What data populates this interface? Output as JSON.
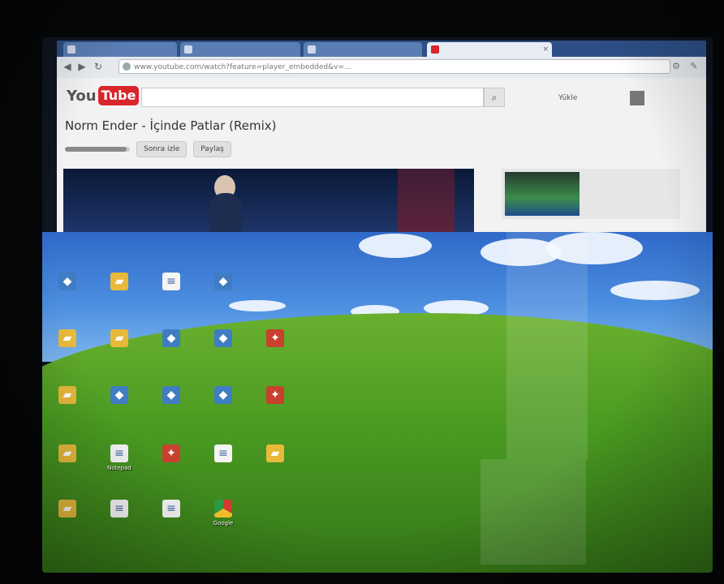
{
  "browser": {
    "tabs": [
      {
        "title": "",
        "active": false
      },
      {
        "title": "",
        "active": false
      },
      {
        "title": "",
        "active": false
      },
      {
        "title": "",
        "active": true
      }
    ],
    "address": "www.youtube.com/watch?feature=player_embedded&v=..."
  },
  "youtube": {
    "logo_you": "You",
    "logo_tube": "Tube",
    "header_links": [
      "Yükle"
    ],
    "video_title": "Norm Ender - İçinde Patlar (Remix)",
    "controls": {
      "progress": 0.95,
      "watch_later": "Sonra izle",
      "share": "Paylaş"
    },
    "related": {
      "title": "",
      "meta": ""
    }
  },
  "desktop": {
    "icons": [
      {
        "label": "",
        "kind": "prog"
      },
      {
        "label": "",
        "kind": "folder"
      },
      {
        "label": "",
        "kind": "doc"
      },
      {
        "label": "",
        "kind": "prog"
      },
      {
        "label": "",
        "kind": "folder"
      },
      {
        "label": "",
        "kind": "folder"
      },
      {
        "label": "",
        "kind": "prog"
      },
      {
        "label": "",
        "kind": "prog"
      },
      {
        "label": "",
        "kind": "red"
      },
      {
        "label": "",
        "kind": "folder"
      },
      {
        "label": "",
        "kind": "prog"
      },
      {
        "label": "",
        "kind": "prog"
      },
      {
        "label": "",
        "kind": "prog"
      },
      {
        "label": "",
        "kind": "red"
      },
      {
        "label": "",
        "kind": "folder"
      },
      {
        "label": "Notepad",
        "kind": "doc"
      },
      {
        "label": "",
        "kind": "red"
      },
      {
        "label": "",
        "kind": "doc"
      },
      {
        "label": "",
        "kind": "folder"
      },
      {
        "label": "",
        "kind": "folder"
      },
      {
        "label": "",
        "kind": "doc"
      },
      {
        "label": "",
        "kind": "doc"
      },
      {
        "label": "Google",
        "kind": "chrome"
      }
    ]
  },
  "colors": {
    "youtube_red": "#d8262b",
    "tabstrip": "#2d4f86",
    "sky": "#4b8ee0",
    "grass": "#4a9a21"
  }
}
